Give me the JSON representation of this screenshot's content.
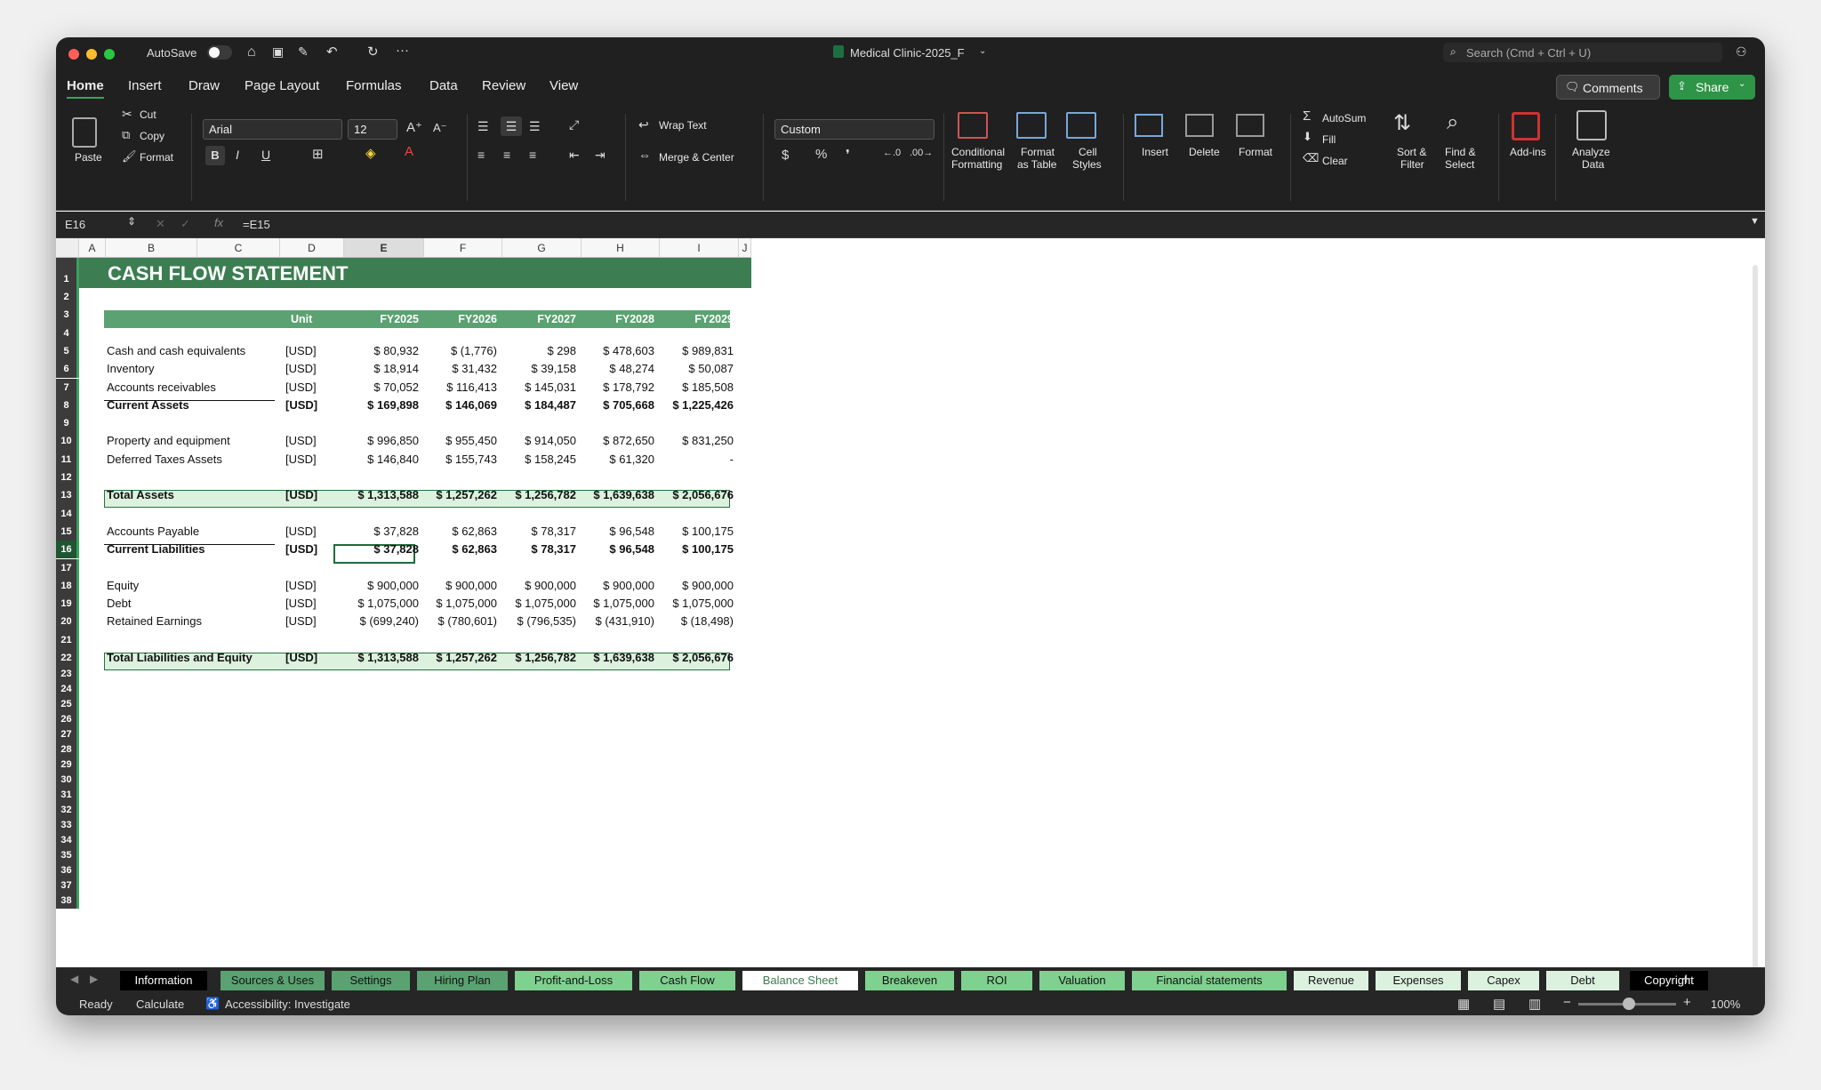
{
  "titlebar": {
    "autosave_label": "AutoSave",
    "doc_title": "Medical Clinic-2025_F",
    "search_placeholder": "Search (Cmd + Ctrl + U)"
  },
  "menu_tabs": [
    "Home",
    "Insert",
    "Draw",
    "Page Layout",
    "Formulas",
    "Data",
    "Review",
    "View"
  ],
  "buttons": {
    "comments": "Comments",
    "share": "Share"
  },
  "ribbon": {
    "paste": "Paste",
    "cut": "Cut",
    "copy": "Copy",
    "format_painter": "Format",
    "font_name": "Arial",
    "font_size": "12",
    "wrap_text": "Wrap Text",
    "merge_center": "Merge & Center",
    "number_format": "Custom",
    "conditional_formatting_1": "Conditional",
    "conditional_formatting_2": "Formatting",
    "format_table_1": "Format",
    "format_table_2": "as Table",
    "cell_styles_1": "Cell",
    "cell_styles_2": "Styles",
    "insert": "Insert",
    "delete": "Delete",
    "format": "Format",
    "autosum": "AutoSum",
    "fill": "Fill",
    "clear": "Clear",
    "sort_filter_1": "Sort &",
    "sort_filter_2": "Filter",
    "find_select_1": "Find &",
    "find_select_2": "Select",
    "addins": "Add-ins",
    "analyze_1": "Analyze",
    "analyze_2": "Data"
  },
  "formula_bar": {
    "name_box": "E16",
    "formula": "=E15"
  },
  "columns": [
    "A",
    "B",
    "C",
    "D",
    "E",
    "F",
    "G",
    "H",
    "I",
    "J"
  ],
  "rows": [
    "1",
    "2",
    "3",
    "4",
    "5",
    "6",
    "7",
    "8",
    "9",
    "10",
    "11",
    "12",
    "13",
    "14",
    "15",
    "16",
    "17",
    "18",
    "19",
    "20",
    "21",
    "22",
    "23",
    "24",
    "25",
    "26",
    "27",
    "28",
    "29",
    "30",
    "31",
    "32",
    "33",
    "34",
    "35",
    "36",
    "37",
    "38"
  ],
  "sheet": {
    "title": "CASH FLOW STATEMENT",
    "headers": [
      "Unit",
      "FY2025",
      "FY2026",
      "FY2027",
      "FY2028",
      "FY2029"
    ],
    "lines": [
      {
        "row": 5,
        "label": "Cash and cash equivalents",
        "unit": "[USD]",
        "values": [
          "$ 80,932",
          "$ (1,776)",
          "$ 298",
          "$ 478,603",
          "$ 989,831"
        ]
      },
      {
        "row": 6,
        "label": "Inventory",
        "unit": "[USD]",
        "values": [
          "$ 18,914",
          "$ 31,432",
          "$ 39,158",
          "$ 48,274",
          "$ 50,087"
        ]
      },
      {
        "row": 7,
        "label": "Accounts receivables",
        "unit": "[USD]",
        "values": [
          "$ 70,052",
          "$ 116,413",
          "$ 145,031",
          "$ 178,792",
          "$ 185,508"
        ]
      },
      {
        "row": 8,
        "label": "Current Assets",
        "unit": "[USD]",
        "values": [
          "$ 169,898",
          "$ 146,069",
          "$ 184,487",
          "$ 705,668",
          "$ 1,225,426"
        ]
      },
      {
        "row": 10,
        "label": "Property and equipment",
        "unit": "[USD]",
        "values": [
          "$ 996,850",
          "$ 955,450",
          "$ 914,050",
          "$ 872,650",
          "$ 831,250"
        ]
      },
      {
        "row": 11,
        "label": "Deferred Taxes Assets",
        "unit": "[USD]",
        "values": [
          "$ 146,840",
          "$ 155,743",
          "$ 158,245",
          "$ 61,320",
          "-"
        ]
      },
      {
        "row": 13,
        "label": "Total Assets",
        "unit": "[USD]",
        "values": [
          "$ 1,313,588",
          "$ 1,257,262",
          "$ 1,256,782",
          "$ 1,639,638",
          "$ 2,056,676"
        ]
      },
      {
        "row": 15,
        "label": "Accounts Payable",
        "unit": "[USD]",
        "values": [
          "$ 37,828",
          "$ 62,863",
          "$ 78,317",
          "$ 96,548",
          "$ 100,175"
        ]
      },
      {
        "row": 16,
        "label": "Current Liabilities",
        "unit": "[USD]",
        "values": [
          "$ 37,828",
          "$ 62,863",
          "$ 78,317",
          "$ 96,548",
          "$ 100,175"
        ]
      },
      {
        "row": 18,
        "label": "Equity",
        "unit": "[USD]",
        "values": [
          "$ 900,000",
          "$ 900,000",
          "$ 900,000",
          "$ 900,000",
          "$ 900,000"
        ]
      },
      {
        "row": 19,
        "label": "Debt",
        "unit": "[USD]",
        "values": [
          "$ 1,075,000",
          "$ 1,075,000",
          "$ 1,075,000",
          "$ 1,075,000",
          "$ 1,075,000"
        ]
      },
      {
        "row": 20,
        "label": "Retained Earnings",
        "unit": "[USD]",
        "values": [
          "$ (699,240)",
          "$ (780,601)",
          "$ (796,535)",
          "$ (431,910)",
          "$ (18,498)"
        ]
      },
      {
        "row": 22,
        "label": "Total Liabilities and Equity",
        "unit": "[USD]",
        "values": [
          "$ 1,313,588",
          "$ 1,257,262",
          "$ 1,256,782",
          "$ 1,639,638",
          "$ 2,056,676"
        ]
      }
    ]
  },
  "sheet_tabs": [
    "Information",
    "Sources & Uses",
    "Settings",
    "Hiring Plan",
    "Profit-and-Loss",
    "Cash Flow",
    "Balance Sheet",
    "Breakeven",
    "ROI",
    "Valuation",
    "Financial statements",
    "Revenue",
    "Expenses",
    "Capex",
    "Debt",
    "Copyright"
  ],
  "status": {
    "ready": "Ready",
    "calculate": "Calculate",
    "accessibility": "Accessibility: Investigate",
    "zoom": "100%"
  },
  "colors": {
    "accent_green": "#5aa271",
    "title_green": "#3c7d52",
    "total_fill": "#dcf2df",
    "share_green": "#2e9447"
  }
}
